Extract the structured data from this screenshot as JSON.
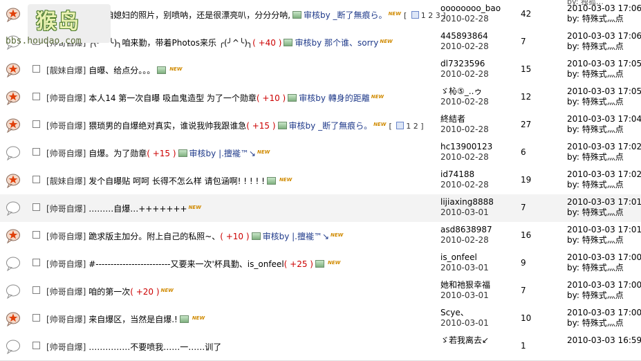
{
  "logo": {
    "text": "猴岛",
    "url": "bbs.houdao.com"
  },
  "top_partial": "by: 独孤…",
  "threads": [
    {
      "icon": "hot",
      "cat": "[靓妹自爆]",
      "title": "爆下咱媳妇的照片，别喷呐，还是很漂亮叭，分分分呐,",
      "plus": "",
      "review": "审核by _断了無痕ら。",
      "img": true,
      "new": "NEW",
      "pages": "1 2 3",
      "author": "oooooooo_bao",
      "date": "2010-02-28",
      "replies": "42",
      "last_time": "2010-03-03 17:06",
      "last_by": "by: 特殊式灬点"
    },
    {
      "icon": "normal",
      "cat": "[帅哥自爆]",
      "title": "╭(╯^╰)╮咱来勤，带着Photos来乐 ╭(╯^╰)╮",
      "plus": "( +40 )",
      "review": "审核by 那个谁、sorry",
      "img": true,
      "new": "NEW",
      "pages": "",
      "author": "445893864",
      "date": "2010-02-28",
      "replies": "7",
      "last_time": "2010-03-03 17:06",
      "last_by": "by: 特殊式灬点"
    },
    {
      "icon": "hot",
      "cat": "[靓妹自爆]",
      "title": "自曝、给点分。。。",
      "plus": "",
      "review": "",
      "img": true,
      "new": "NEW",
      "pages": "",
      "author": "dl7323596",
      "date": "2010-02-28",
      "replies": "15",
      "last_time": "2010-03-03 17:05",
      "last_by": "by: 特殊式灬点"
    },
    {
      "icon": "hot",
      "cat": "[帅哥自爆]",
      "title": "本人14  第一次自曝 吸血鬼造型  为了一个勋章",
      "plus": "( +10 )",
      "review": "审核by 轉身的距離",
      "img": true,
      "new": "NEW",
      "pages": "",
      "author": "ゞ杺⑤_..ゥ",
      "date": "2010-02-28",
      "replies": "12",
      "last_time": "2010-03-03 17:05",
      "last_by": "by: 特殊式灬点"
    },
    {
      "icon": "hot",
      "cat": "[帅哥自爆]",
      "title": "猥琐男的自爆绝对真实，谁说我帅我跟谁急",
      "plus": "( +15 )",
      "review": "审核by _断了無痕ら。",
      "img": true,
      "new": "NEW",
      "pages": "1 2",
      "author": "終結者",
      "date": "2010-02-28",
      "replies": "27",
      "last_time": "2010-03-03 17:04",
      "last_by": "by: 特殊式灬点"
    },
    {
      "icon": "normal",
      "cat": "[帅哥自爆]",
      "title": "自爆。为了勋章",
      "plus": "( +15 )",
      "review": "审核by |.擅褦™↘",
      "img": true,
      "new": "NEW",
      "pages": "",
      "author": "hc13900123",
      "date": "2010-02-28",
      "replies": "6",
      "last_time": "2010-03-03 17:02",
      "last_by": "by: 特殊式灬点"
    },
    {
      "icon": "hot",
      "cat": "[靓妹自爆]",
      "title": "发个自曝贴 呵呵 长得不怎么样 请包涵啊! ! ! ! !",
      "plus": "",
      "review": "",
      "img": true,
      "new": "NEW",
      "pages": "",
      "author": "id74188",
      "date": "2010-02-28",
      "replies": "19",
      "last_time": "2010-03-03 17:02",
      "last_by": "by: 特殊式灬点"
    },
    {
      "icon": "normal",
      "cat": "[帅哥自爆]",
      "title": "………自爆…+++++++",
      "plus": "",
      "review": "",
      "img": false,
      "new": "NEW",
      "pages": "",
      "author": "lijiaxing8888",
      "date": "2010-03-01",
      "replies": "7",
      "last_time": "2010-03-03 17:01",
      "last_by": "by: 特殊式灬点"
    },
    {
      "icon": "hot",
      "cat": "[帅哥自爆]",
      "title": "跪求版主加分。附上自己的私照~、",
      "plus": "( +10 )",
      "review": "审核by |.擅褦™↘",
      "img": true,
      "new": "NEW",
      "pages": "",
      "author": "asd8638987",
      "date": "2010-02-28",
      "replies": "16",
      "last_time": "2010-03-03 17:01",
      "last_by": "by: 特殊式灬点"
    },
    {
      "icon": "normal",
      "cat": "[帅哥自爆]",
      "title": "#-------------------------又要来一次'杯具勤、is_onfeel",
      "plus": "( +25 )",
      "review": "",
      "img": true,
      "new": "NEW",
      "pages": "",
      "author": "is_onfeel",
      "date": "2010-03-01",
      "replies": "9",
      "last_time": "2010-03-03 17:00",
      "last_by": "by: 特殊式灬点"
    },
    {
      "icon": "normal",
      "cat": "[帅哥自爆]",
      "title": "咱的第一次",
      "plus": "( +20 )",
      "review": "",
      "img": false,
      "new": "NEW",
      "pages": "",
      "author": "她和祂狠幸福",
      "date": "2010-03-01",
      "replies": "7",
      "last_time": "2010-03-03 17:00",
      "last_by": "by: 特殊式灬点"
    },
    {
      "icon": "hot",
      "cat": "[帅哥自爆]",
      "title": "来自爆区，当然是自爆.!",
      "plus": "",
      "review": "",
      "img": true,
      "new": "NEW",
      "pages": "",
      "author": "Scye、",
      "date": "2010-03-01",
      "replies": "10",
      "last_time": "2010-03-03 17:00",
      "last_by": "by: 特殊式灬点"
    },
    {
      "icon": "normal",
      "cat": "[帅哥自爆]",
      "title": "……………不要喷我……一……训了",
      "plus": "",
      "review": "",
      "img": false,
      "new": "",
      "pages": "",
      "author": "ゞ若我离去↙",
      "date": "",
      "replies": "1",
      "last_time": "2010-03-03 16:59",
      "last_by": ""
    }
  ]
}
